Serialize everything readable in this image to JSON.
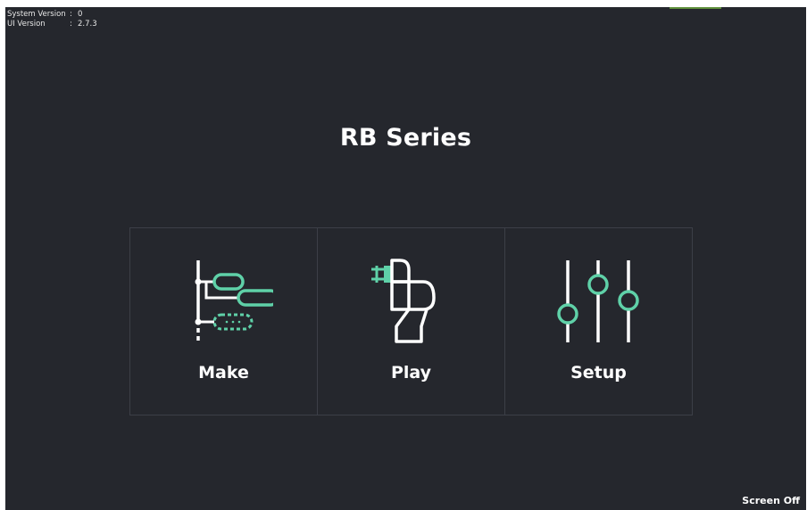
{
  "colors": {
    "background": "#25272d",
    "accent": "#5fd1a8",
    "status_bar": "#5e8f3a"
  },
  "version_info": {
    "system_label": "System Version",
    "system_value": "0",
    "ui_label": "UI Version",
    "ui_value": "2.7.3",
    "separator": ":"
  },
  "title": "RB Series",
  "menu": [
    {
      "label": "Make",
      "icon": "program-tree-icon"
    },
    {
      "label": "Play",
      "icon": "robot-arm-icon"
    },
    {
      "label": "Setup",
      "icon": "sliders-icon"
    }
  ],
  "screen_off_label": "Screen Off"
}
